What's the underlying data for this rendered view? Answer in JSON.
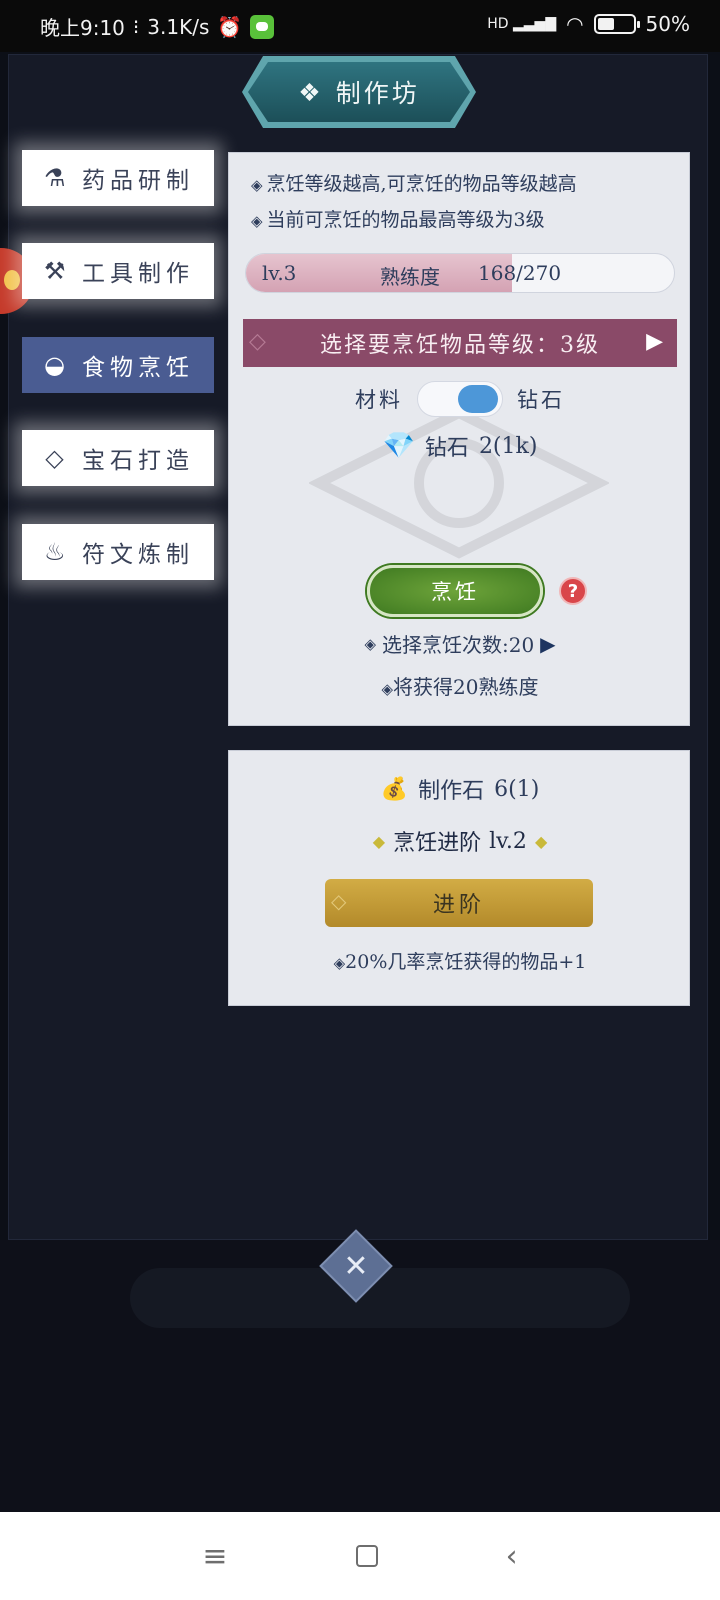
{
  "status_bar": {
    "time": "晚上9:10",
    "speed": "3.1K/s",
    "network_label": "HD",
    "battery_percent": "50%"
  },
  "header": {
    "title": "制作坊"
  },
  "sidebar": {
    "items": [
      {
        "label": "药品研制",
        "icon": "potion-icon"
      },
      {
        "label": "工具制作",
        "icon": "shovel-icon"
      },
      {
        "label": "食物烹饪",
        "icon": "bowl-icon",
        "active": true
      },
      {
        "label": "宝石打造",
        "icon": "gem-icon"
      },
      {
        "label": "符文炼制",
        "icon": "flame-icon"
      }
    ]
  },
  "cooking_panel": {
    "hint1": "烹饪等级越高,可烹饪的物品等级越高",
    "hint2": "当前可烹饪的物品最高等级为3级",
    "proficiency": {
      "level": "lv.3",
      "label": "熟练度",
      "value_text": "168/270",
      "current": 168,
      "max": 270
    },
    "level_select_label": "选择要烹饪物品等级：3级",
    "toggle": {
      "left_label": "材料",
      "right_label": "钻石",
      "selected": "钻石"
    },
    "cost": {
      "label": "钻石",
      "value": "2(1k)"
    },
    "cook_button": "烹饪",
    "count_label": "选择烹饪次数:20",
    "gain_label": "将获得20熟练度"
  },
  "advance_panel": {
    "stone_label": "制作石",
    "stone_value": "6(1)",
    "advance_label": "烹饪进阶",
    "advance_level": "lv.2",
    "advance_button": "进阶",
    "bonus_text": "20%几率烹饪获得的物品+1"
  },
  "colors": {
    "active_tab": "#4a5c92",
    "cook_button": "#4f8a2b",
    "advance_button": "#c29a35",
    "level_select": "#8a4a68"
  }
}
